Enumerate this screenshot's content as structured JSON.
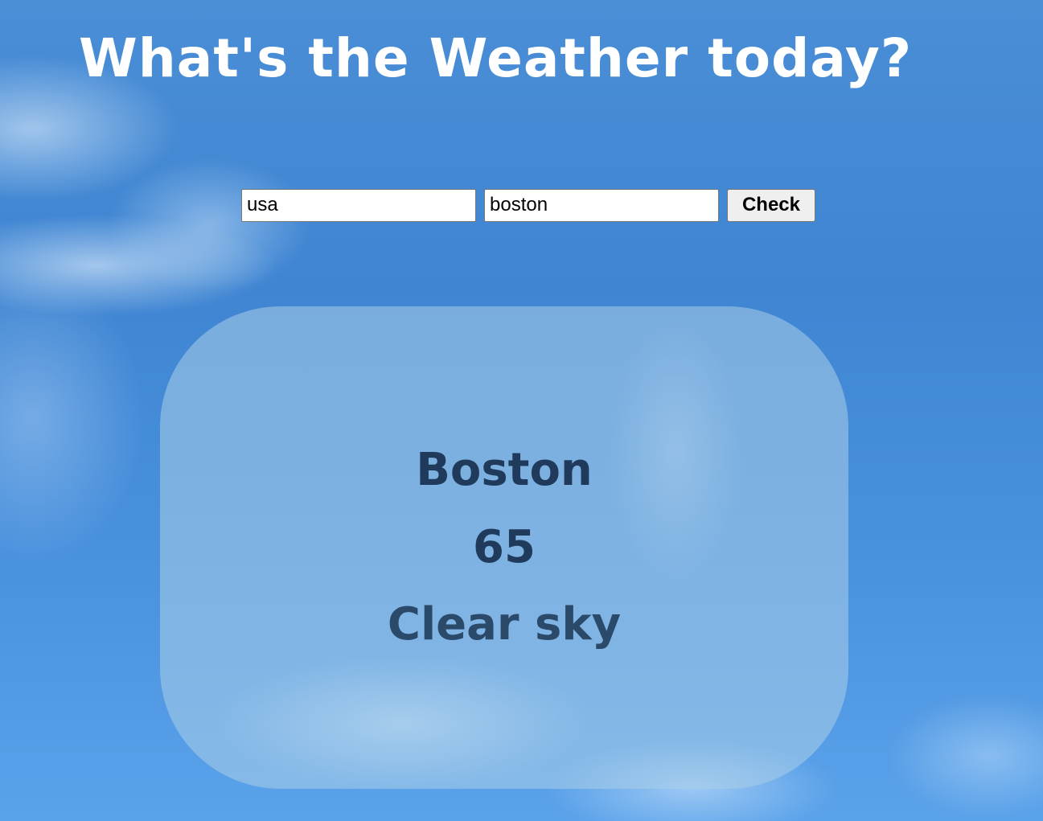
{
  "header": {
    "title": "What's the Weather today?"
  },
  "search": {
    "country_value": "usa",
    "city_value": "boston",
    "check_label": "Check"
  },
  "result": {
    "city": "Boston",
    "temperature": "65",
    "description": "Clear sky"
  },
  "colors": {
    "title_text": "#ffffff",
    "result_text": "#1f3a5a",
    "card_background": "rgba(170, 205, 232, 0.55)",
    "sky_background": "#4a8ed6"
  }
}
